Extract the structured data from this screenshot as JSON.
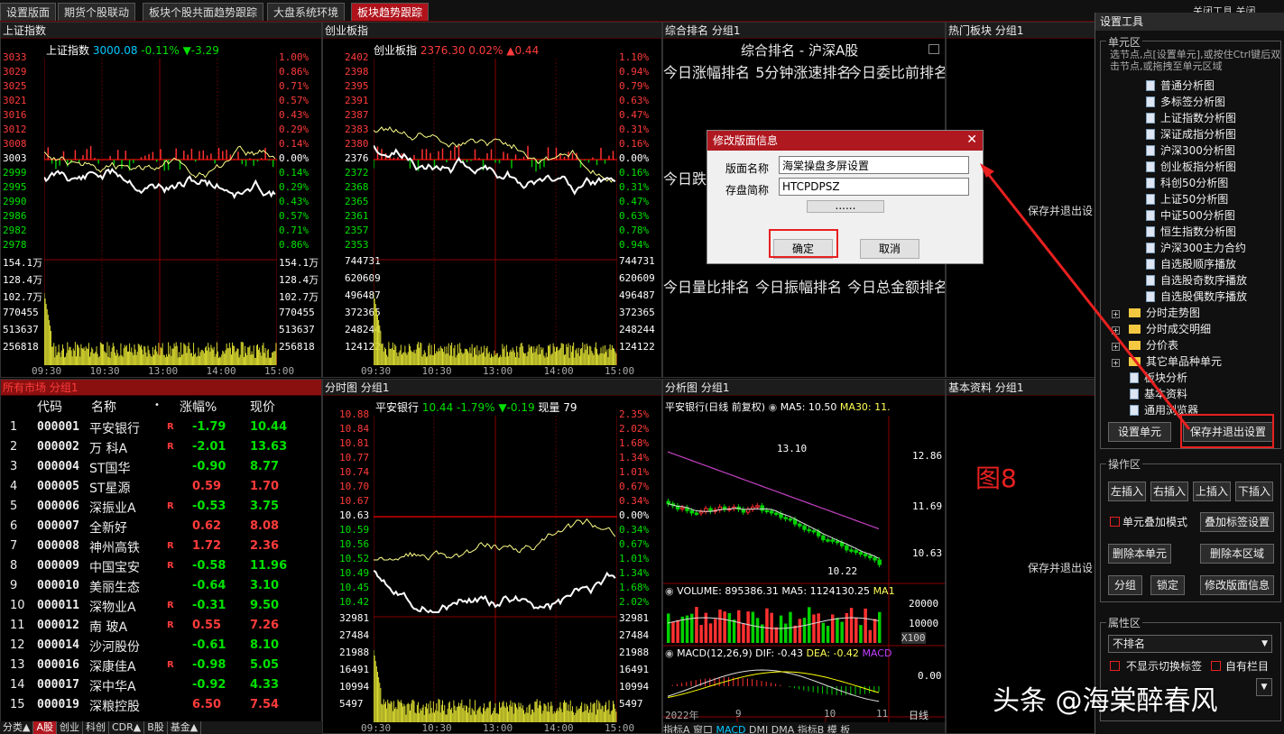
{
  "tabs": [
    "设置版面",
    "期货个股联动",
    "板块个股共面趋势跟踪",
    "大盘系统环境",
    "板块趋势跟踪"
  ],
  "topright": "关闭工具  关闭",
  "sh": {
    "panel": "上证指数",
    "title": "上证指数",
    "price": "3000.08",
    "pct": "-0.11%",
    "chg": "▼-3.29",
    "left_ticks": [
      "3033",
      "3029",
      "3025",
      "3021",
      "3016",
      "3012",
      "3008",
      "3003",
      "2999",
      "2995",
      "2990",
      "2986",
      "2982",
      "2978"
    ],
    "right_ticks": [
      "1.00%",
      "0.86%",
      "0.71%",
      "0.57%",
      "0.43%",
      "0.29%",
      "0.14%",
      "0.00%",
      "0.14%",
      "0.29%",
      "0.43%",
      "0.57%",
      "0.71%",
      "0.86%"
    ],
    "vol_left": [
      "154.1万",
      "128.4万",
      "102.7万",
      "770455",
      "513637",
      "256818"
    ],
    "vol_right": [
      "154.1万",
      "128.4万",
      "102.7万",
      "770455",
      "513637",
      "256818"
    ]
  },
  "cy": {
    "panel": "创业板指",
    "title": "创业板指",
    "price": "2376.30",
    "pct": "0.02%",
    "chg": "▲0.44",
    "left_ticks": [
      "2402",
      "2398",
      "2395",
      "2391",
      "2387",
      "2383",
      "2380",
      "2376",
      "2372",
      "2368",
      "2365",
      "2361",
      "2357",
      "2353"
    ],
    "right_ticks": [
      "1.10%",
      "0.94%",
      "0.79%",
      "0.63%",
      "0.47%",
      "0.31%",
      "0.16%",
      "0.00%",
      "0.16%",
      "0.31%",
      "0.47%",
      "0.63%",
      "0.78%",
      "0.94%"
    ],
    "vol_left": [
      "744731",
      "620609",
      "496487",
      "372365",
      "248244",
      "124122"
    ],
    "vol_right": [
      "744731",
      "620609",
      "496487",
      "372365",
      "248244",
      "124122"
    ]
  },
  "time_axis": [
    "09:30",
    "10:30",
    "13:00",
    "14:00",
    "15:00"
  ],
  "rank": {
    "panel": "综合排名 分组1",
    "title": "综合排名 - 沪深A股",
    "headers": [
      "今日涨幅排名",
      "5分钟涨速排名",
      "今日委比前排名",
      "今日跌",
      "今日量比排名",
      "今日振幅排名",
      "今日总金额排名"
    ]
  },
  "hot": {
    "panel": "热门板块 分组1",
    "save_hint": "保存并退出设"
  },
  "basic": {
    "panel": "基本资料 分组1",
    "save_hint": "保存并退出设",
    "fig": "图8"
  },
  "market": {
    "panel": "所有市场 分组1",
    "cols": [
      "代码",
      "名称",
      "•",
      "涨幅%",
      "现价"
    ],
    "rows": [
      [
        "1",
        "000001",
        "平安银行",
        "R",
        "-1.79",
        "10.44"
      ],
      [
        "2",
        "000002",
        "万 科A",
        "R",
        "-2.01",
        "13.63"
      ],
      [
        "3",
        "000004",
        "ST国华",
        "",
        "-0.90",
        "8.77"
      ],
      [
        "4",
        "000005",
        "ST星源",
        "",
        "0.59",
        "1.70"
      ],
      [
        "5",
        "000006",
        "深振业A",
        "R",
        "-0.53",
        "3.75"
      ],
      [
        "6",
        "000007",
        "全新好",
        "",
        "0.62",
        "8.08"
      ],
      [
        "7",
        "000008",
        "神州高铁",
        "R",
        "1.72",
        "2.36"
      ],
      [
        "8",
        "000009",
        "中国宝安",
        "R",
        "-0.58",
        "11.96"
      ],
      [
        "9",
        "000010",
        "美丽生态",
        "",
        "-0.64",
        "3.10"
      ],
      [
        "10",
        "000011",
        "深物业A",
        "R",
        "-0.31",
        "9.50"
      ],
      [
        "11",
        "000012",
        "南 玻A",
        "R",
        "0.55",
        "7.26"
      ],
      [
        "12",
        "000014",
        "沙河股份",
        "",
        "-0.61",
        "8.10"
      ],
      [
        "13",
        "000016",
        "深康佳A",
        "R",
        "-0.98",
        "5.05"
      ],
      [
        "14",
        "000017",
        "深中华A",
        "",
        "-0.92",
        "4.33"
      ],
      [
        "15",
        "000019",
        "深粮控股",
        "",
        "6.50",
        "7.54"
      ]
    ]
  },
  "bottom_tabs": [
    "分类▲",
    "A股",
    "创业",
    "科创",
    "CDR▲",
    "B股",
    "基金▲"
  ],
  "fs": {
    "panel": "分时图 分组1",
    "title": "平安银行",
    "price": "10.44",
    "pct": "-1.79%",
    "chg": "▼-0.19",
    "now": "现量 79",
    "left_ticks": [
      "10.88",
      "10.84",
      "10.81",
      "10.77",
      "10.74",
      "10.70",
      "10.67",
      "10.63",
      "10.59",
      "10.56",
      "10.52",
      "10.49",
      "10.45",
      "10.42"
    ],
    "right_ticks": [
      "2.35%",
      "2.02%",
      "1.68%",
      "1.34%",
      "1.01%",
      "0.67%",
      "0.34%",
      "0.00%",
      "0.34%",
      "0.67%",
      "1.01%",
      "1.34%",
      "1.68%",
      "2.02%"
    ],
    "vol_left": [
      "32981",
      "27484",
      "21988",
      "16491",
      "10994",
      "5497"
    ],
    "vol_right": [
      "32981",
      "27484",
      "21988",
      "16491",
      "10994",
      "5497"
    ]
  },
  "kl": {
    "panel": "分析图 分组1",
    "title": "平安银行(日线 前复权)",
    "ma5": "MA5: 10.50",
    "ma30": "MA30: 11.",
    "ticks": [
      "12.86",
      "11.69",
      "10.63"
    ],
    "high": "13.10",
    "low": "10.22",
    "vol": "VOLUME: 895386.31",
    "vol_ma5": "MA5: 1124130.25",
    "vol_ma1": "MA1",
    "vol_ticks": [
      "20000",
      "10000"
    ],
    "x100": "X100",
    "macd": "MACD(12,26,9)",
    "dif": "DIF: -0.43",
    "dea": "DEA: -0.42",
    "macd2": "MACD",
    "macd_tick": "0.00",
    "x_labels": [
      "2022年",
      "9",
      "10",
      "11"
    ],
    "dayline": "日线",
    "tabs": [
      "指标A",
      "窗口",
      "MACD",
      "DMI",
      "DMA",
      "指标B",
      "模",
      "板"
    ]
  },
  "dialog": {
    "title": "修改版面信息",
    "name_label": "版面名称",
    "name_value": "海棠操盘多屏设置",
    "short_label": "存盘简称",
    "short_value": "HTCPDPSZ",
    "dots": "......",
    "ok": "确定",
    "cancel": "取消"
  },
  "tool": {
    "title": "设置工具",
    "unit_section": "单元区",
    "hint": "选节点,点[设置单元],或按住Ctrl键后双击节点,或拖拽至单元区域",
    "items": [
      "普通分析图",
      "多标签分析图",
      "上证指数分析图",
      "深证成指分析图",
      "沪深300分析图",
      "创业板指分析图",
      "科创50分析图",
      "上证50分析图",
      "中证500分析图",
      "恒生指数分析图",
      "沪深300主力合约",
      "自选股顺序播放",
      "自选股奇数序播放",
      "自选股偶数序播放"
    ],
    "folders": [
      "分时走势图",
      "分时成交明细",
      "分价表",
      "其它单品种单元"
    ],
    "items2": [
      "板块分析",
      "基本资料",
      "通用浏览器"
    ],
    "set_unit": "设置单元",
    "save_exit": "保存并退出设置",
    "ops_section": "操作区",
    "left_insert": "左插入",
    "right_insert": "右插入",
    "up_insert": "上插入",
    "down_insert": "下插入",
    "overlay_mode": "单元叠加模式",
    "overlay_tab": "叠加标签设置",
    "del_unit": "删除本单元",
    "del_area": "删除本区域",
    "split": "分组",
    "lock": "锁定",
    "edit_layout": "修改版面信息",
    "attr_section": "属性区",
    "sort": "不排名",
    "no_switch": "不显示切换标签",
    "own_bar": "自有栏目"
  },
  "watermark": "头条 @海棠醉春风"
}
